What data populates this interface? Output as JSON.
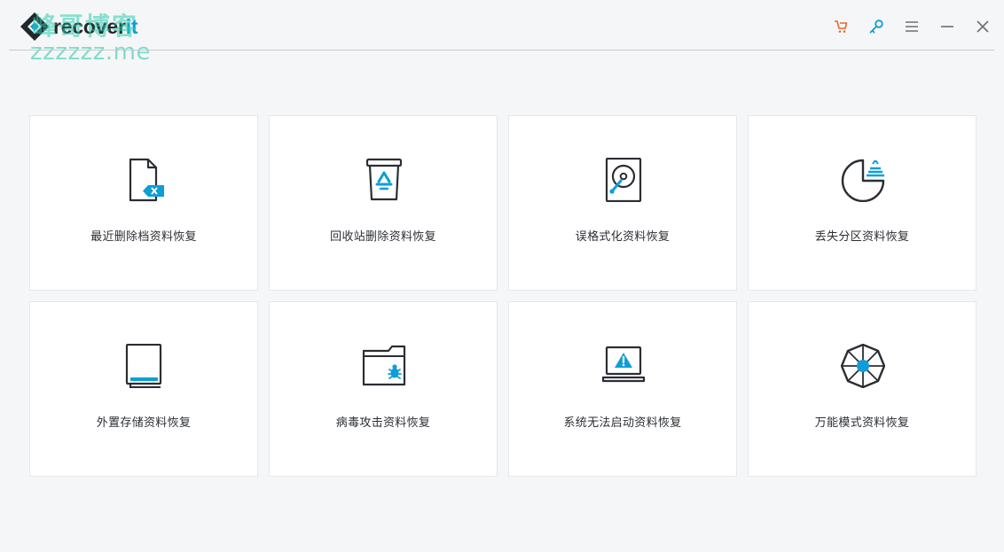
{
  "app": {
    "logo_text_main": "recover",
    "logo_text_accent": "it",
    "watermark_cn": "峰哥博客",
    "watermark_url": "zzzzzz.me"
  },
  "titlebar": {
    "icons": [
      "cart-icon",
      "key-icon",
      "menu-icon",
      "minimize-icon",
      "close-icon"
    ],
    "accent_color": "#0d9ed8",
    "cart_color": "#e8672e"
  },
  "cards": [
    {
      "label": "最近删除档资料恢复",
      "icon": "deleted-file-icon"
    },
    {
      "label": "回收站删除资料恢复",
      "icon": "recycle-bin-icon"
    },
    {
      "label": "误格式化资料恢复",
      "icon": "hard-drive-icon"
    },
    {
      "label": "丢失分区资料恢复",
      "icon": "lost-partition-icon"
    },
    {
      "label": "外置存储资料恢复",
      "icon": "external-drive-icon"
    },
    {
      "label": "病毒攻击资料恢复",
      "icon": "virus-folder-icon"
    },
    {
      "label": "系统无法启动资料恢复",
      "icon": "laptop-warning-icon"
    },
    {
      "label": "万能模式资料恢复",
      "icon": "all-around-icon"
    }
  ]
}
